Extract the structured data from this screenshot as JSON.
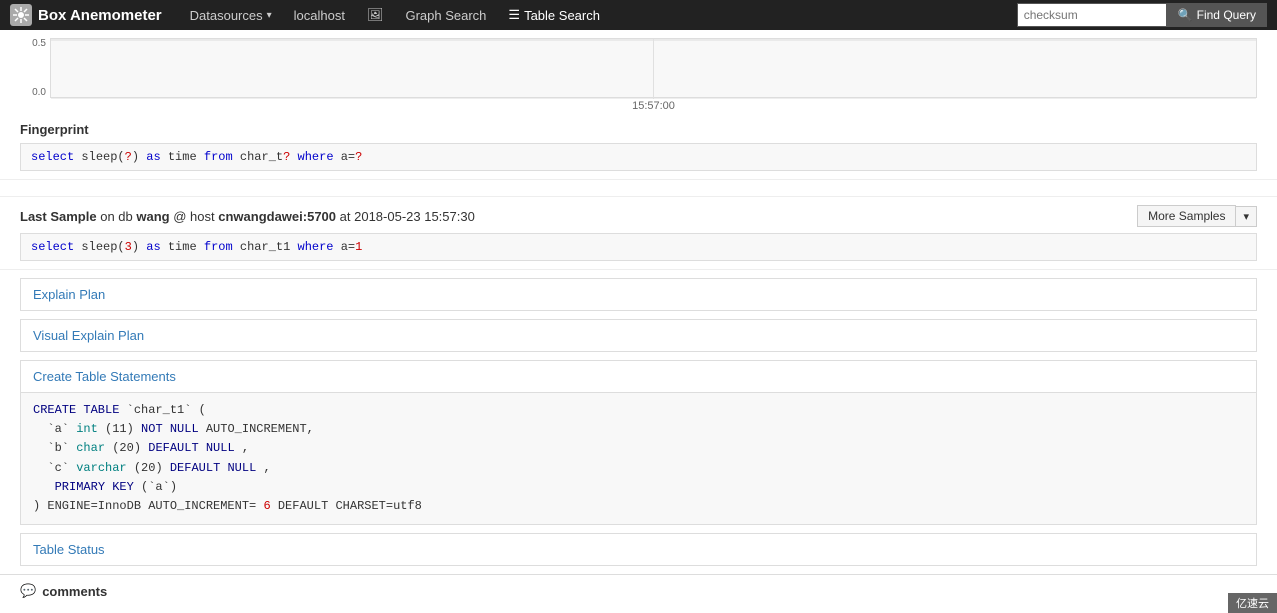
{
  "navbar": {
    "brand_icon": "❄",
    "brand_name": "Box Anemometer",
    "links": [
      {
        "label": "Datasources",
        "has_dropdown": true,
        "active": false
      },
      {
        "label": "localhost",
        "has_dropdown": false,
        "active": false
      },
      {
        "label": "⬜",
        "icon": "image-icon",
        "has_dropdown": false,
        "active": false
      },
      {
        "label": "Graph Search",
        "has_dropdown": false,
        "active": false
      },
      {
        "label": "☰",
        "icon": "table-icon"
      },
      {
        "label": "Table Search",
        "has_dropdown": false,
        "active": true
      }
    ],
    "search_placeholder": "checksum",
    "find_query_label": "Find Query"
  },
  "chart": {
    "y_top": "0.5",
    "y_bottom": "0.0",
    "x_label": "15:57:00"
  },
  "fingerprint": {
    "label": "Fingerprint",
    "code": "select sleep(?) as time from char_t? where a=?"
  },
  "last_sample": {
    "prefix": "Last Sample",
    "on_text": "on db",
    "db_name": "wang",
    "host_text": "@ host",
    "host_value": "cnwangdawei:5700",
    "at_text": "at",
    "timestamp": "2018-05-23 15:57:30",
    "more_samples_label": "More Samples",
    "code": "select sleep(3) as time from char_t1 where a=1"
  },
  "sections": {
    "explain_plan": "Explain Plan",
    "visual_explain_plan": "Visual Explain Plan",
    "create_table_statements": "Create Table Statements",
    "table_status": "Table Status"
  },
  "create_table_code": {
    "line1": "CREATE TABLE `char_t1` (",
    "line2": "  `a` int(11) NOT NULL AUTO_INCREMENT,",
    "line3": "  `b` char(20) DEFAULT NULL,",
    "line4": "  `c` varchar(20) DEFAULT NULL,",
    "line5": "  PRIMARY KEY (`a`)",
    "line6": ") ENGINE=InnoDB AUTO_INCREMENT=6 DEFAULT CHARSET=utf8"
  },
  "comments": {
    "icon": "💬",
    "label": "comments"
  },
  "footer": {
    "brand": "亿速云"
  }
}
